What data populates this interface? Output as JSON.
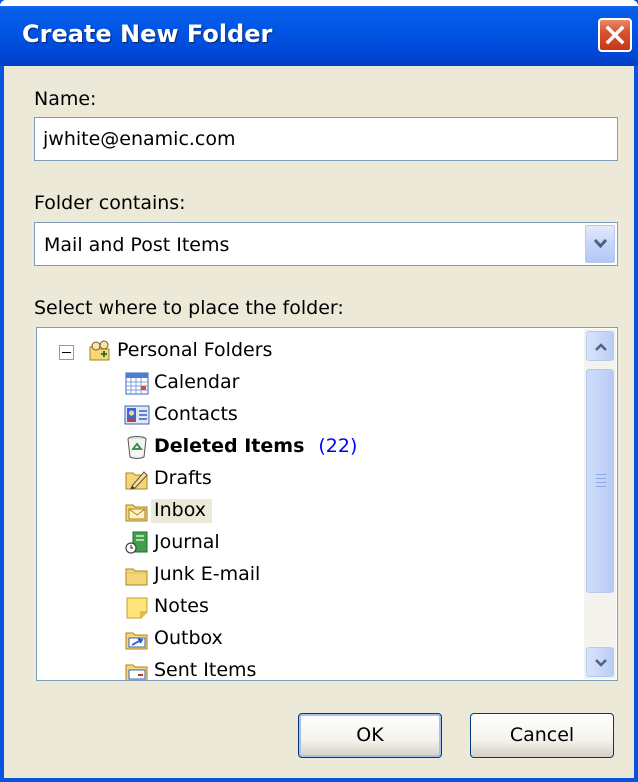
{
  "window": {
    "title": "Create New Folder"
  },
  "name_field": {
    "label": "Name:",
    "value": "jwhite@enamic.com"
  },
  "folder_contains": {
    "label": "Folder contains:",
    "selected": "Mail and Post Items"
  },
  "folder_tree": {
    "label": "Select where to place the folder:",
    "root": "Personal Folders",
    "items": [
      {
        "label": "Calendar",
        "icon": "calendar-icon"
      },
      {
        "label": "Contacts",
        "icon": "contacts-icon"
      },
      {
        "label": "Deleted Items",
        "icon": "deleted-items-icon",
        "count": "(22)"
      },
      {
        "label": "Drafts",
        "icon": "drafts-icon"
      },
      {
        "label": "Inbox",
        "icon": "inbox-icon"
      },
      {
        "label": "Journal",
        "icon": "journal-icon"
      },
      {
        "label": "Junk E-mail",
        "icon": "folder-icon"
      },
      {
        "label": "Notes",
        "icon": "notes-icon"
      },
      {
        "label": "Outbox",
        "icon": "outbox-icon"
      },
      {
        "label": "Sent Items",
        "icon": "sent-items-icon"
      }
    ],
    "selected_index": 4
  },
  "buttons": {
    "ok_label": "OK",
    "cancel_label": "Cancel"
  },
  "colors": {
    "title_bar": "#0055e5",
    "dialog_background": "#ece9d8",
    "count_text": "#0000ff"
  }
}
